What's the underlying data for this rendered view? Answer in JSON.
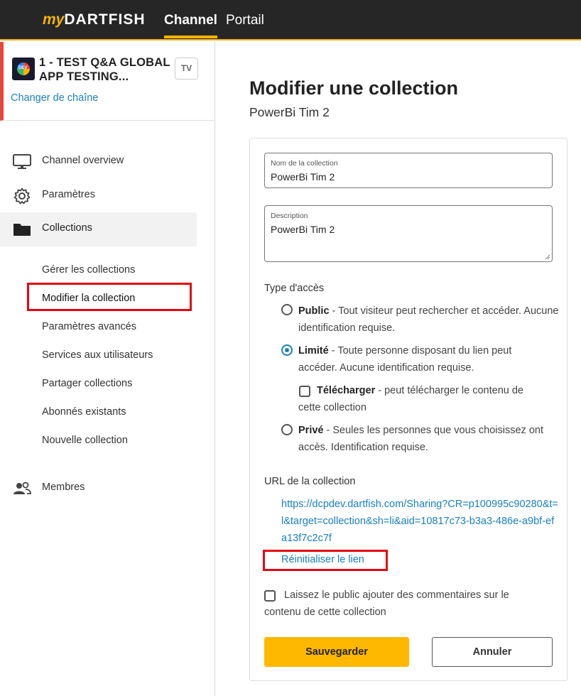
{
  "topbar": {
    "logo_my": "my",
    "logo_brand": "DARTFISH",
    "nav": [
      "Channel",
      "Portail"
    ]
  },
  "sidebar": {
    "channel_title": "1 - TEST Q&A GLOBAL APP TESTING...",
    "channel_badge": "TV",
    "change_channel": "Changer de chaîne",
    "items": [
      {
        "label": "Channel overview",
        "icon": "monitor-icon"
      },
      {
        "label": "Paramètres",
        "icon": "gear-icon"
      },
      {
        "label": "Collections",
        "icon": "folder-icon"
      },
      {
        "label": "Membres",
        "icon": "users-icon"
      }
    ],
    "sub_items": [
      "Gérer les collections",
      "Modifier la collection",
      "Paramètres avancés",
      "Services aux utilisateurs",
      "Partager collections",
      "Abonnés existants",
      "Nouvelle collection"
    ]
  },
  "main": {
    "title": "Modifier une collection",
    "subtitle": "PowerBi Tim 2",
    "name_field": {
      "label": "Nom de la collection",
      "value": "PowerBi Tim 2"
    },
    "description_field": {
      "label": "Description",
      "value": "PowerBi Tim 2"
    },
    "access_label": "Type d'accès",
    "options": {
      "public": {
        "title": "Public",
        "text": " - Tout visiteur peut rechercher et accéder. Aucune identification requise."
      },
      "limited": {
        "title": "Limité",
        "text": " - Toute personne disposant du lien peut accéder. Aucune identification requise."
      },
      "download": {
        "title": "Télécharger",
        "text": " - peut télécharger le contenu de cette collection"
      },
      "private": {
        "title": "Privé",
        "text": " - Seules les personnes que vous choisissez ont accès. Identification requise."
      }
    },
    "selected_access": "limited",
    "url_label": "URL de la collection",
    "url": "https://dcpdev.dartfish.com/Sharing?CR=p100995c90280&t=l&target=collection&sh=li&aid=10817c73-b3a3-486e-a9bf-efa13f7c2c7f",
    "reset_link": "Réinitialiser le lien",
    "comments_label": "Laissez le public ajouter des commentaires sur le contenu de cette collection",
    "save_label": "Sauvegarder",
    "cancel_label": "Annuler"
  }
}
